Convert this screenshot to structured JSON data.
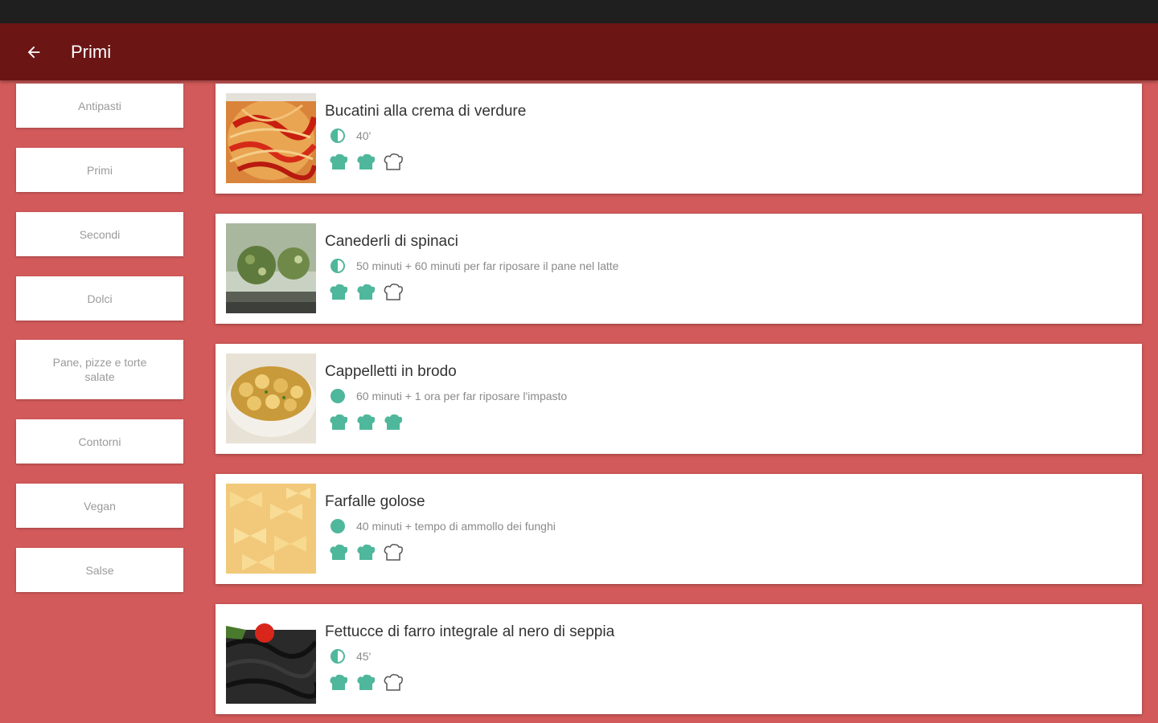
{
  "header": {
    "title": "Primi",
    "back_icon": "arrow-back-icon"
  },
  "colors": {
    "background": "#d35a5a",
    "app_bar": "#6b1515",
    "status_bar": "#1f1f1f",
    "accent": "#4fb79b"
  },
  "sidebar": {
    "items": [
      {
        "label": "Antipasti"
      },
      {
        "label": "Primi"
      },
      {
        "label": "Secondi"
      },
      {
        "label": "Dolci"
      },
      {
        "label": "Pane, pizze e torte salate"
      },
      {
        "label": "Contorni"
      },
      {
        "label": "Vegan"
      },
      {
        "label": "Salse"
      }
    ]
  },
  "recipes": [
    {
      "title": "Bucatini alla crema di verdure",
      "time": "40'",
      "time_icon": "half-clock-icon",
      "difficulty": 2,
      "difficulty_max": 3
    },
    {
      "title": "Canederli di spinaci",
      "time": "50 minuti + 60 minuti per far riposare il pane nel latte",
      "time_icon": "half-clock-icon",
      "difficulty": 2,
      "difficulty_max": 3
    },
    {
      "title": "Cappelletti in brodo",
      "time": "60 minuti + 1 ora per far riposare l'impasto",
      "time_icon": "full-clock-icon",
      "difficulty": 3,
      "difficulty_max": 3
    },
    {
      "title": "Farfalle golose",
      "time": "40 minuti + tempo di ammollo dei funghi",
      "time_icon": "full-clock-icon",
      "difficulty": 2,
      "difficulty_max": 3
    },
    {
      "title": "Fettucce di farro integrale al nero di seppia",
      "time": "45'",
      "time_icon": "half-clock-icon",
      "difficulty": 2,
      "difficulty_max": 3
    }
  ]
}
